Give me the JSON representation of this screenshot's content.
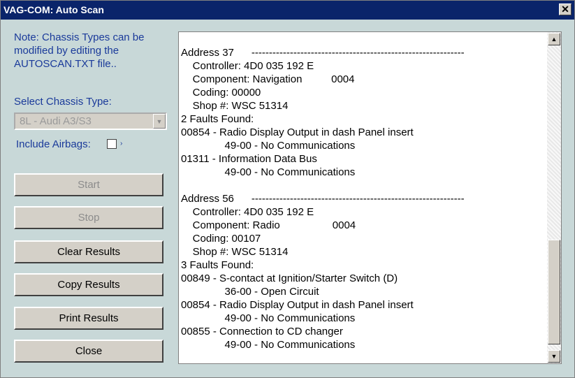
{
  "window": {
    "title": "VAG-COM: Auto Scan",
    "close_glyph": "✕"
  },
  "note": "Note:  Chassis Types can be modified by editing the AUTOSCAN.TXT file..",
  "chassis": {
    "label": "Select Chassis Type:",
    "selected": "8L - Audi A3/S3",
    "arrow": "▼"
  },
  "airbags": {
    "label": "Include Airbags:",
    "checked": false,
    "extra": "›"
  },
  "buttons": {
    "start": "Start",
    "stop": "Stop",
    "clear": "Clear Results",
    "copy": "Copy Results",
    "print": "Print Results",
    "close": "Close"
  },
  "scrollbar": {
    "up": "▲",
    "down": "▼"
  },
  "results": [
    "Address 37      -------------------------------------------------------------",
    "    Controller: 4D0 035 192 E",
    "    Component: Navigation          0004",
    "    Coding: 00000",
    "    Shop #: WSC 51314",
    "2 Faults Found:",
    "00854 - Radio Display Output in dash Panel insert",
    "               49-00 - No Communications",
    "01311 - Information Data Bus",
    "               49-00 - No Communications",
    "",
    "Address 56      -------------------------------------------------------------",
    "    Controller: 4D0 035 192 E",
    "    Component: Radio                  0004",
    "    Coding: 00107",
    "    Shop #: WSC 51314",
    "3 Faults Found:",
    "00849 - S-contact at Ignition/Starter Switch (D)",
    "               36-00 - Open Circuit",
    "00854 - Radio Display Output in dash Panel insert",
    "               49-00 - No Communications",
    "00855 - Connection to CD changer",
    "               49-00 - No Communications"
  ]
}
